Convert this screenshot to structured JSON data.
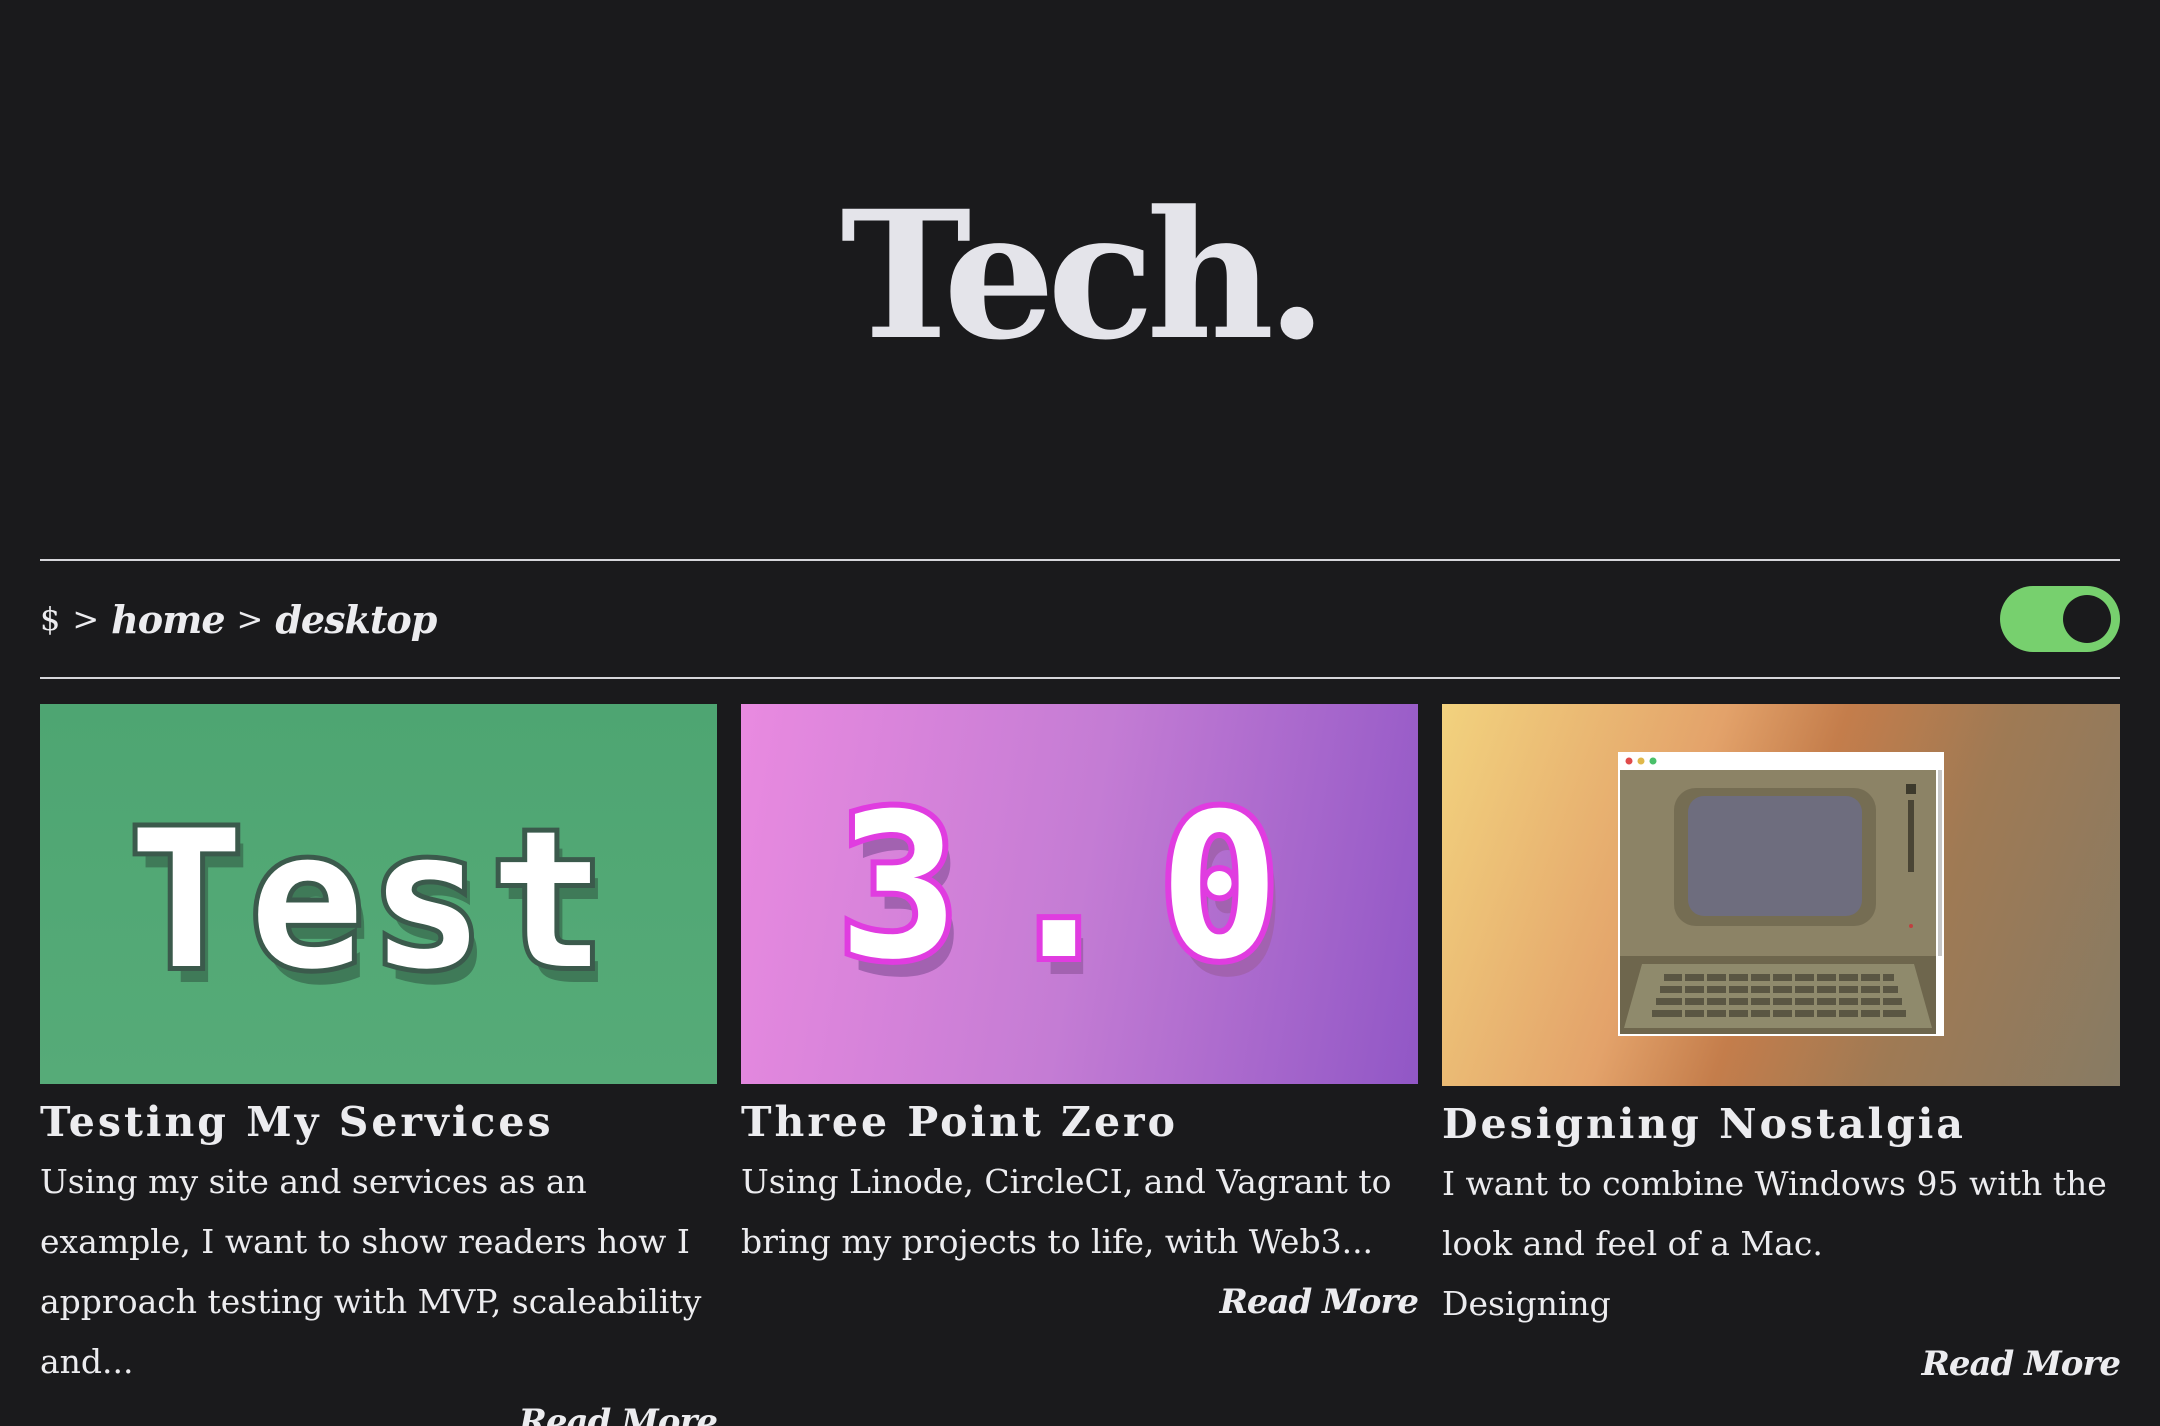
{
  "site": {
    "title": "Tech."
  },
  "breadcrumb": {
    "prompt": "$",
    "separator": ">",
    "items": [
      "home",
      "desktop"
    ]
  },
  "theme_toggle": {
    "state": "on",
    "color": "#77d06e"
  },
  "posts": [
    {
      "thumbnail_text": "Test",
      "title": "Testing My Services",
      "description": "Using my site and services as an example, I want to show readers how I approach testing with MVP, scaleability and...",
      "read_more": "Read More"
    },
    {
      "thumbnail_text": "3.0",
      "title": "Three Point Zero",
      "description": "Using Linode, CircleCI, and Vagrant to bring my projects to life, with Web3...",
      "read_more": "Read More"
    },
    {
      "thumbnail_text": "",
      "title": "Designing Nostalgia",
      "description": "I want to combine Windows 95 with the look and feel of a Mac.",
      "tag": "Designing",
      "read_more": "Read More"
    }
  ],
  "colors": {
    "background": "#1a1a1c",
    "text": "#ececef",
    "accent_green": "#77d06e",
    "thumb_pixel_magenta": "#e03ce0"
  }
}
